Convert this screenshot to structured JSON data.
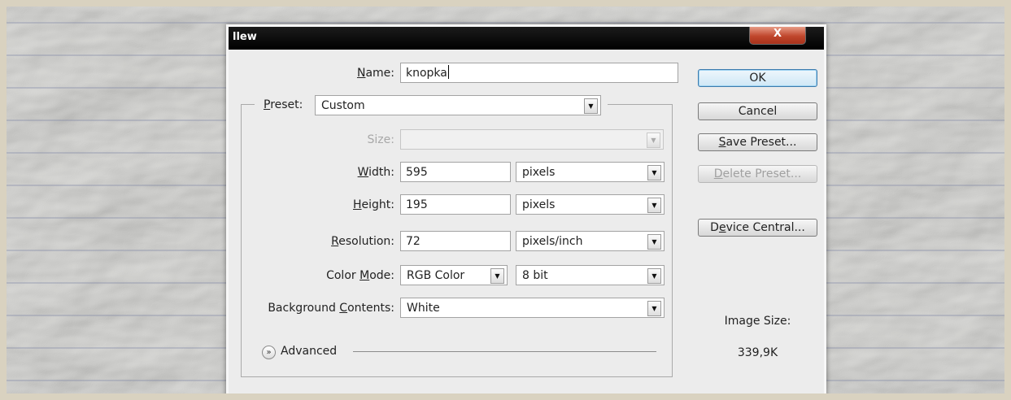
{
  "dialog": {
    "title": "llew",
    "close_label": "X",
    "name": {
      "label": "Name:",
      "mnemonic": "N",
      "rest": "ame:",
      "value": "knopka"
    },
    "preset": {
      "mnemonic": "P",
      "rest": "reset:",
      "value": "Custom"
    },
    "size": {
      "label": "Size:",
      "value": ""
    },
    "width": {
      "mnemonic": "W",
      "rest": "idth:",
      "value": "595",
      "unit": "pixels"
    },
    "height": {
      "mnemonic": "H",
      "rest": "eight:",
      "value": "195",
      "unit": "pixels"
    },
    "resolution": {
      "mnemonic": "R",
      "rest": "esolution:",
      "value": "72",
      "unit": "pixels/inch"
    },
    "color_mode": {
      "prefix": "Color ",
      "mnemonic": "M",
      "rest": "ode:",
      "value": "RGB Color",
      "depth": "8 bit"
    },
    "background": {
      "prefix": "Background ",
      "mnemonic": "C",
      "rest": "ontents:",
      "value": "White"
    },
    "advanced_label": "Advanced",
    "buttons": {
      "ok": "OK",
      "cancel": "Cancel",
      "save_preset_m": "S",
      "save_preset_rest": "ave Preset...",
      "delete_preset_m": "D",
      "delete_preset_rest": "elete Preset...",
      "device_central_pre": "D",
      "device_central_m": "e",
      "device_central_rest": "vice Central..."
    },
    "image_size": {
      "label": "Image Size:",
      "value": "339,9K"
    }
  },
  "colors": {
    "titlebar": "#000000",
    "close_button": "#c0462c",
    "dialog_bg": "#ececec",
    "ok_border": "#3d7bad"
  }
}
